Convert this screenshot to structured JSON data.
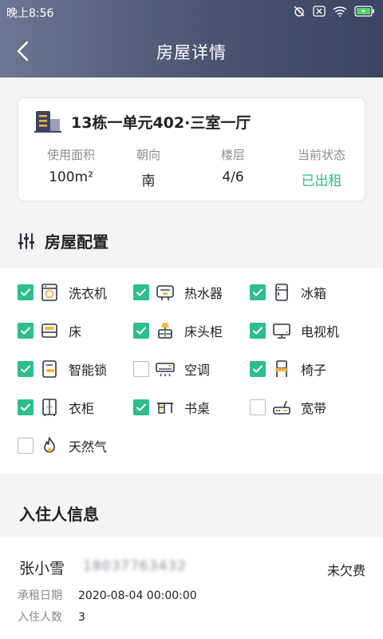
{
  "status_bar": {
    "time": "晚上8:56"
  },
  "nav": {
    "title": "房屋详情"
  },
  "house": {
    "title": "13栋一单元402·三室一厅",
    "stats": [
      {
        "label": "使用面积",
        "value": "100m²"
      },
      {
        "label": "朝向",
        "value": "南"
      },
      {
        "label": "楼层",
        "value": "4/6"
      },
      {
        "label": "当前状态",
        "value": "已出租"
      }
    ]
  },
  "config": {
    "title": "房屋配置",
    "items": [
      {
        "label": "洗衣机",
        "checked": true,
        "icon": "washing-machine-icon"
      },
      {
        "label": "热水器",
        "checked": true,
        "icon": "water-heater-icon"
      },
      {
        "label": "冰箱",
        "checked": true,
        "icon": "fridge-icon"
      },
      {
        "label": "床",
        "checked": true,
        "icon": "bed-icon"
      },
      {
        "label": "床头柜",
        "checked": true,
        "icon": "nightstand-icon"
      },
      {
        "label": "电视机",
        "checked": true,
        "icon": "tv-icon"
      },
      {
        "label": "智能锁",
        "checked": true,
        "icon": "smart-lock-icon"
      },
      {
        "label": "空调",
        "checked": false,
        "icon": "air-conditioner-icon"
      },
      {
        "label": "椅子",
        "checked": true,
        "icon": "chair-icon"
      },
      {
        "label": "衣柜",
        "checked": true,
        "icon": "wardrobe-icon"
      },
      {
        "label": "书桌",
        "checked": true,
        "icon": "desk-icon"
      },
      {
        "label": "宽带",
        "checked": false,
        "icon": "router-icon"
      },
      {
        "label": "天然气",
        "checked": false,
        "icon": "gas-flame-icon"
      }
    ]
  },
  "tenant_section": {
    "title": "入住人信息"
  },
  "tenant": {
    "name": "张小雪",
    "phone": "18037763432",
    "fee_status": "未欠费",
    "rent_date_label": "承租日期",
    "rent_date": "2020-08-04 00:00:00",
    "count_label": "入住人数",
    "count": "3"
  },
  "colors": {
    "accent": "#2dbd8e",
    "header_dark": "#3d4462",
    "header_light": "#6e7594"
  }
}
